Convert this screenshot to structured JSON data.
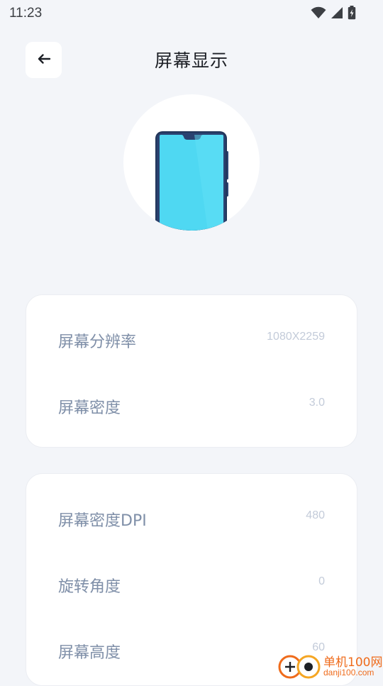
{
  "status_bar": {
    "time": "11:23",
    "icons": [
      "wifi-icon",
      "cell-signal-icon",
      "battery-charging-icon"
    ]
  },
  "header": {
    "back_icon": "arrow-left-icon",
    "title": "屏幕显示"
  },
  "hero": {
    "icon": "smartphone-illustration",
    "colors": {
      "screen": "#4fd8f2",
      "body": "#22365a",
      "circle": "#ffffff"
    }
  },
  "cards": [
    {
      "rows": [
        {
          "label": "屏幕分辨率",
          "value": "1080X2259"
        },
        {
          "label": "屏幕密度",
          "value": "3.0"
        }
      ]
    },
    {
      "rows": [
        {
          "label": "屏幕密度DPI",
          "value": "480"
        },
        {
          "label": "旋转角度",
          "value": "0"
        },
        {
          "label": "屏幕高度",
          "value": "60"
        }
      ]
    }
  ],
  "watermark": {
    "cn": "单机100网",
    "en": "danji100.com",
    "color": "#ef6b1b"
  },
  "colors": {
    "background": "#f3f5f9",
    "label": "#7f8fa8",
    "value": "#c3cbd9"
  }
}
